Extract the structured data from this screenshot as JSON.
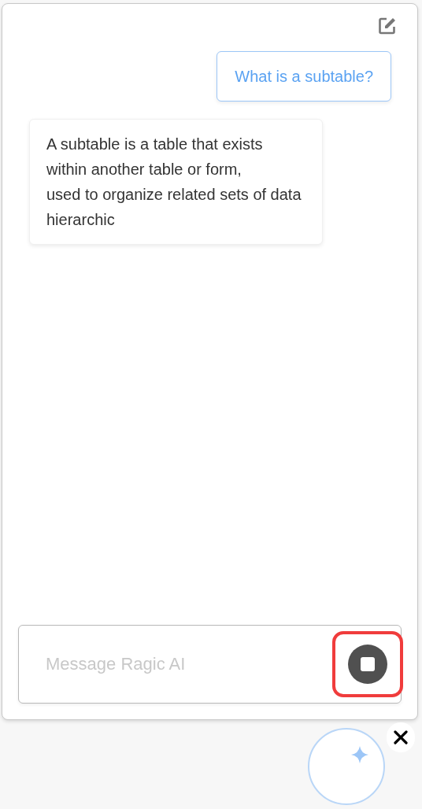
{
  "chat": {
    "messages": [
      {
        "kind": "user",
        "text": "What is a subtable?"
      },
      {
        "kind": "assistant",
        "text": "A subtable is a table that exists\nwithin another table or form,\nused to organize related sets of data\nhierarchic"
      }
    ]
  },
  "composer": {
    "placeholder": "Message Ragic AI",
    "generating": true,
    "highlighted": true
  },
  "launcher": {
    "open": true
  }
}
